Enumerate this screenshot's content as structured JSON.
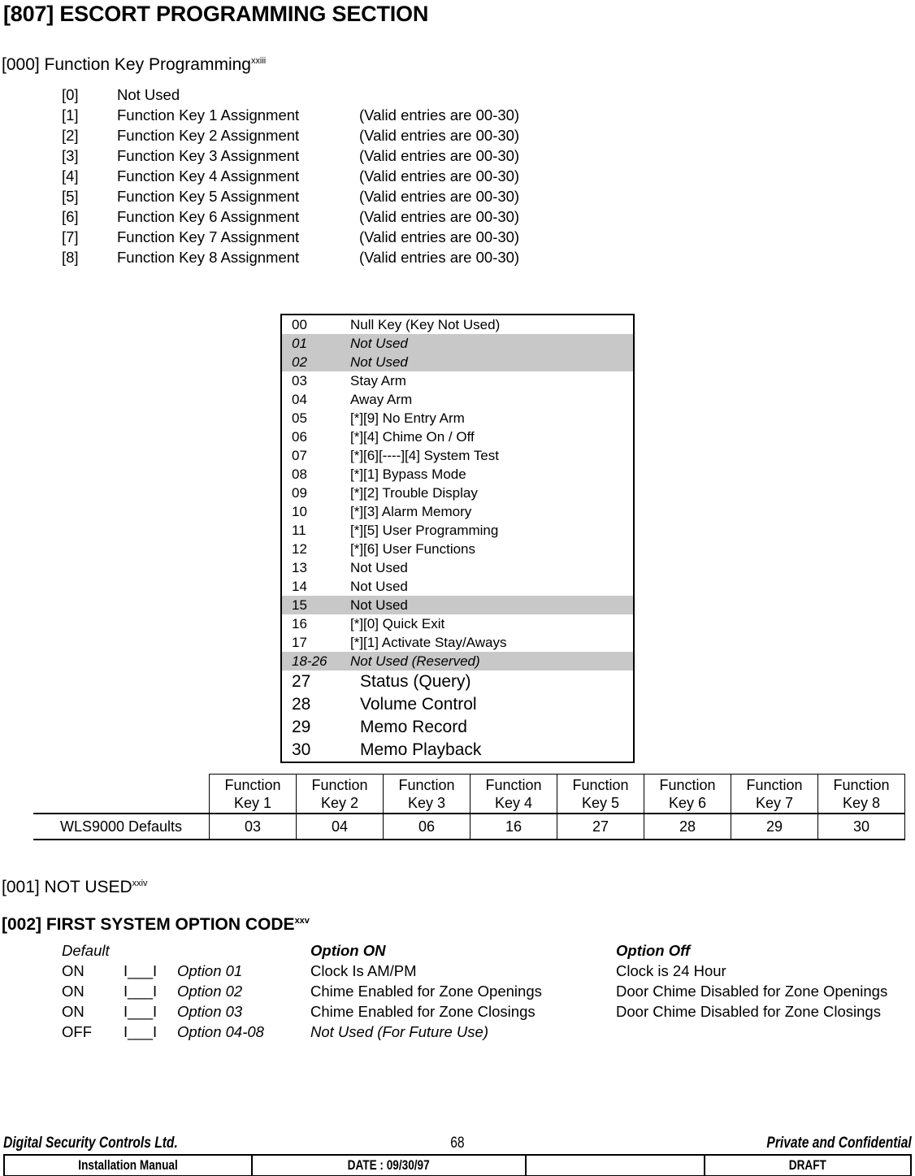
{
  "title": "[807] ESCORT PROGRAMMING SECTION",
  "sections": {
    "func_key": {
      "label": "[000] Function Key Programming",
      "superscript": "xxiii",
      "entries": [
        {
          "index": "[0]",
          "name": "Not Used",
          "valid": ""
        },
        {
          "index": "[1]",
          "name": "Function Key 1 Assignment",
          "valid": "(Valid entries are 00-30)"
        },
        {
          "index": "[2]",
          "name": "Function Key 2 Assignment",
          "valid": "(Valid entries are 00-30)"
        },
        {
          "index": "[3]",
          "name": "Function Key 3 Assignment",
          "valid": "(Valid entries are 00-30)"
        },
        {
          "index": "[4]",
          "name": "Function Key 4 Assignment",
          "valid": "(Valid entries are 00-30)"
        },
        {
          "index": "[5]",
          "name": "Function Key 5 Assignment",
          "valid": "(Valid entries are 00-30)"
        },
        {
          "index": "[6]",
          "name": "Function Key 6 Assignment",
          "valid": "(Valid entries are 00-30)"
        },
        {
          "index": "[7]",
          "name": "Function Key 7 Assignment",
          "valid": "(Valid entries are 00-30)"
        },
        {
          "index": "[8]",
          "name": "Function Key 8 Assignment",
          "valid": "(Valid entries are 00-30)"
        }
      ]
    },
    "not_used": {
      "label": "[001] NOT USED",
      "superscript": "xxiv"
    },
    "first_system_option": {
      "label": "[002] FIRST SYSTEM OPTION CODE",
      "superscript": "xxv",
      "headers": {
        "default": "Default",
        "box": "",
        "name": "",
        "option_on": "Option ON",
        "option_off": "Option Off"
      },
      "rows": [
        {
          "default": "ON",
          "box": "I___I",
          "name": "Option 01",
          "option_on": "Clock Is AM/PM",
          "option_off": "Clock is 24 Hour",
          "italic_desc": false
        },
        {
          "default": "ON",
          "box": "I___I",
          "name": "Option 02",
          "option_on": "Chime Enabled for Zone Openings",
          "option_off": "Door Chime Disabled for Zone Openings",
          "italic_desc": false
        },
        {
          "default": "ON",
          "box": "I___I",
          "name": "Option 03",
          "option_on": "Chime Enabled for Zone Closings",
          "option_off": "Door Chime Disabled for Zone Closings",
          "italic_desc": false
        },
        {
          "default": "OFF",
          "box": "I___I",
          "name": "Option 04-08",
          "option_on": "Not Used (For Future Use)",
          "option_off": "",
          "italic_desc": true
        }
      ]
    }
  },
  "code_table": {
    "rows": [
      {
        "code": "00",
        "desc": "Null Key (Key Not Used)",
        "shaded": false,
        "italic": false,
        "big": false
      },
      {
        "code": "01",
        "desc": "Not Used",
        "shaded": true,
        "italic": true,
        "big": false
      },
      {
        "code": "02",
        "desc": "Not Used",
        "shaded": true,
        "italic": true,
        "big": false
      },
      {
        "code": "03",
        "desc": "Stay Arm",
        "shaded": false,
        "italic": false,
        "big": false
      },
      {
        "code": "04",
        "desc": "Away Arm",
        "shaded": false,
        "italic": false,
        "big": false
      },
      {
        "code": "05",
        "desc": "[*][9] No Entry Arm",
        "shaded": false,
        "italic": false,
        "big": false
      },
      {
        "code": "06",
        "desc": "[*][4] Chime On / Off",
        "shaded": false,
        "italic": false,
        "big": false
      },
      {
        "code": "07",
        "desc": "[*][6][----][4] System Test",
        "shaded": false,
        "italic": false,
        "big": false
      },
      {
        "code": "08",
        "desc": "[*][1] Bypass Mode",
        "shaded": false,
        "italic": false,
        "big": false
      },
      {
        "code": "09",
        "desc": "[*][2] Trouble Display",
        "shaded": false,
        "italic": false,
        "big": false
      },
      {
        "code": "10",
        "desc": "[*][3] Alarm Memory",
        "shaded": false,
        "italic": false,
        "big": false
      },
      {
        "code": "11",
        "desc": "[*][5] User Programming",
        "shaded": false,
        "italic": false,
        "big": false
      },
      {
        "code": "12",
        "desc": "[*][6] User Functions",
        "shaded": false,
        "italic": false,
        "big": false
      },
      {
        "code": "13",
        "desc": "Not Used",
        "shaded": false,
        "italic": false,
        "big": false
      },
      {
        "code": "14",
        "desc": "Not Used",
        "shaded": false,
        "italic": false,
        "big": false
      },
      {
        "code": "15",
        "desc": "Not Used",
        "shaded": true,
        "italic": false,
        "big": false
      },
      {
        "code": "16",
        "desc": "[*][0] Quick Exit",
        "shaded": false,
        "italic": false,
        "big": false
      },
      {
        "code": "17",
        "desc": "[*][1] Activate Stay/Aways",
        "shaded": false,
        "italic": false,
        "big": false
      },
      {
        "code": "18-26",
        "desc": "Not Used (Reserved)",
        "shaded": true,
        "italic": true,
        "big": false
      },
      {
        "code": "27",
        "desc": "Status (Query)",
        "shaded": false,
        "italic": false,
        "big": true
      },
      {
        "code": "28",
        "desc": "Volume Control",
        "shaded": false,
        "italic": false,
        "big": true
      },
      {
        "code": "29",
        "desc": "Memo Record",
        "shaded": false,
        "italic": false,
        "big": true
      },
      {
        "code": "30",
        "desc": "Memo Playback",
        "shaded": false,
        "italic": false,
        "big": true
      }
    ]
  },
  "defaults_table": {
    "corner": "",
    "row_label": "WLS9000 Defaults",
    "columns": [
      {
        "line1": "Function",
        "line2": "Key 1",
        "value": "03"
      },
      {
        "line1": "Function",
        "line2": "Key 2",
        "value": "04"
      },
      {
        "line1": "Function",
        "line2": "Key 3",
        "value": "06"
      },
      {
        "line1": "Function",
        "line2": "Key 4",
        "value": "16"
      },
      {
        "line1": "Function",
        "line2": "Key 5",
        "value": "27"
      },
      {
        "line1": "Function",
        "line2": "Key 6",
        "value": "28"
      },
      {
        "line1": "Function",
        "line2": "Key 7",
        "value": "29"
      },
      {
        "line1": "Function",
        "line2": "Key 8",
        "value": "30"
      }
    ]
  },
  "footer": {
    "company": "Digital Security Controls Ltd.",
    "page_number": "68",
    "confidentiality": "Private and Confidential",
    "cells": {
      "manual": "Installation Manual",
      "date": "DATE :  09/30/97",
      "blank": "",
      "status": "DRAFT"
    }
  },
  "colors": {
    "shaded_row": "#c8c8c8",
    "text": "#000000",
    "background": "#ffffff"
  }
}
